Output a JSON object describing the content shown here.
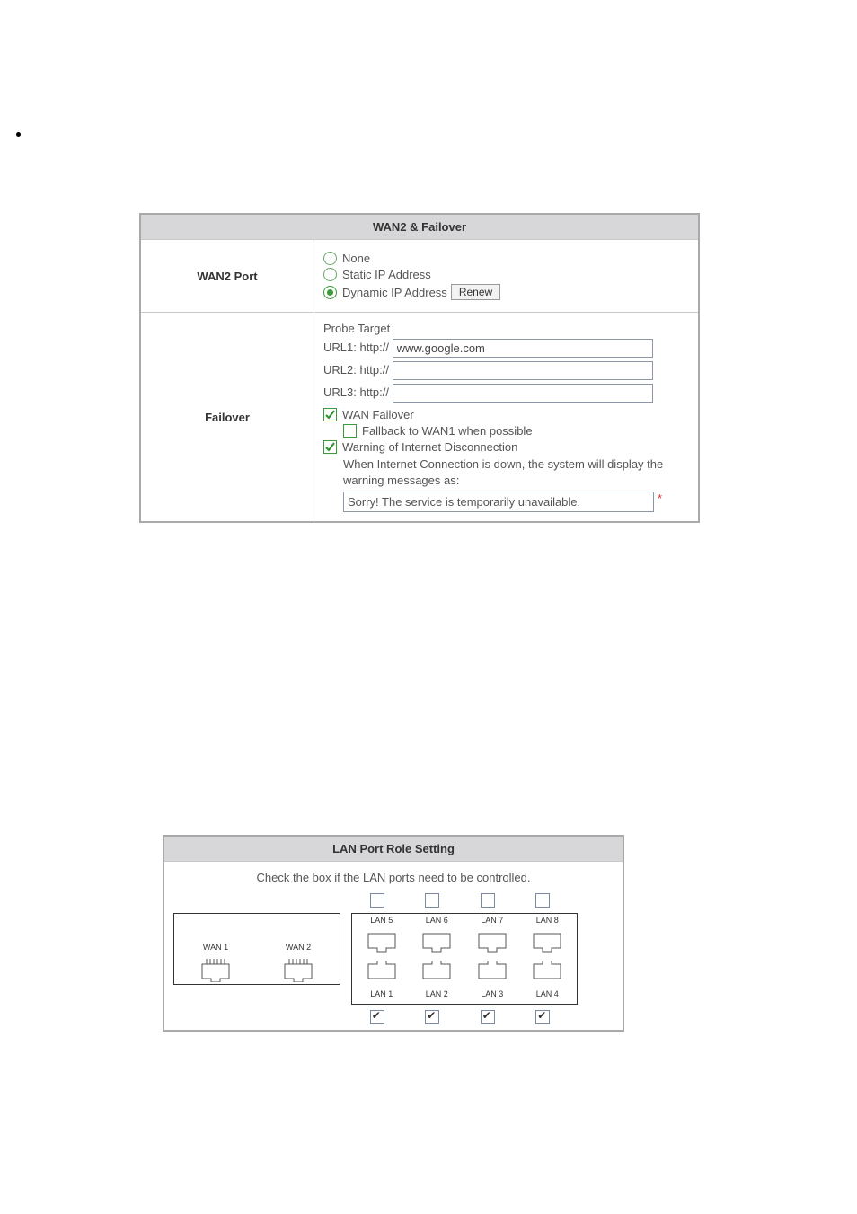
{
  "panel1": {
    "header": "WAN2 & Failover",
    "row1_label": "WAN2 Port",
    "row2_label": "Failover",
    "wan2": {
      "opt_none": "None",
      "opt_static": "Static IP Address",
      "opt_dynamic": "Dynamic IP Address",
      "renew_btn": "Renew"
    },
    "failover": {
      "probe_target": "Probe Target",
      "url1_label": "URL1: http://",
      "url1_value": "www.google.com",
      "url2_label": "URL2: http://",
      "url2_value": "",
      "url3_label": "URL3: http://",
      "url3_value": "",
      "wan_failover": "WAN Failover",
      "fallback": "Fallback to WAN1 when possible",
      "warn_disc": "Warning of Internet Disconnection",
      "warn_desc": "When Internet Connection is down, the system will display the warning messages as:",
      "warn_msg": "Sorry! The service is temporarily unavailable.",
      "star": "*"
    }
  },
  "panel2": {
    "header": "LAN Port Role Setting",
    "desc": "Check the box if the LAN ports need to be controlled.",
    "wan1": "WAN 1",
    "wan2": "WAN 2",
    "lan_top": [
      "LAN 5",
      "LAN 6",
      "LAN 7",
      "LAN 8"
    ],
    "lan_bot": [
      "LAN 1",
      "LAN 2",
      "LAN 3",
      "LAN 4"
    ]
  }
}
